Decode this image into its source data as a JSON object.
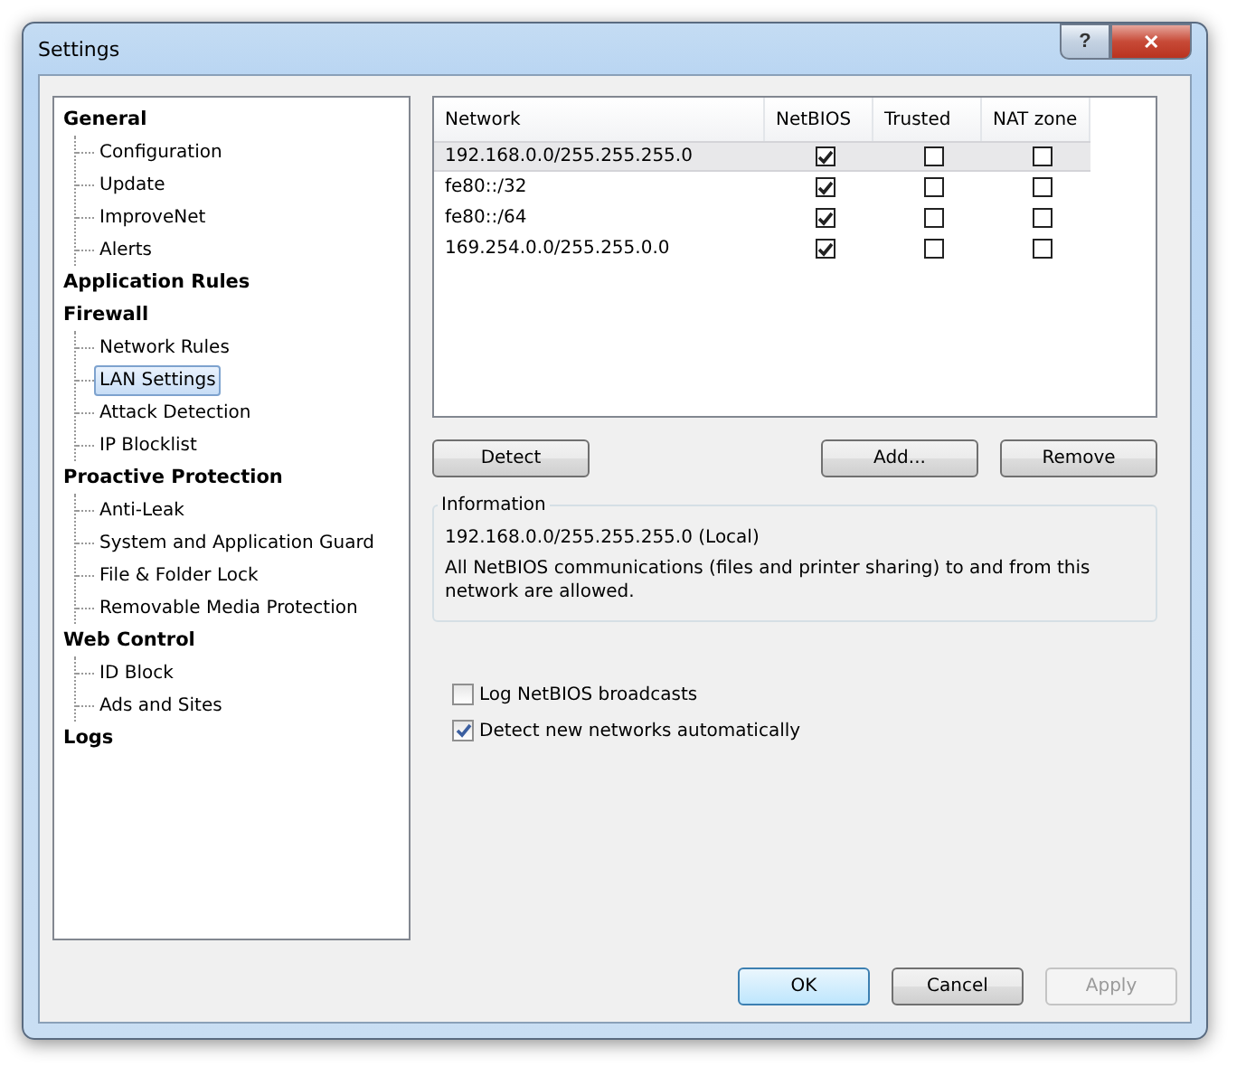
{
  "window": {
    "title": "Settings"
  },
  "title_buttons": [
    {
      "kind": "help",
      "label": "?"
    },
    {
      "kind": "close",
      "label": "✕"
    }
  ],
  "sidebar": {
    "items": [
      {
        "label": "General",
        "selected": false,
        "children": [
          {
            "label": "Configuration",
            "selected": false
          },
          {
            "label": "Update",
            "selected": false
          },
          {
            "label": "ImproveNet",
            "selected": false
          },
          {
            "label": "Alerts",
            "selected": false
          }
        ]
      },
      {
        "label": "Application Rules",
        "selected": false
      },
      {
        "label": "Firewall",
        "selected": false,
        "children": [
          {
            "label": "Network Rules",
            "selected": false
          },
          {
            "label": "LAN Settings",
            "selected": true
          },
          {
            "label": "Attack Detection",
            "selected": false
          },
          {
            "label": "IP Blocklist",
            "selected": false
          }
        ]
      },
      {
        "label": "Proactive Protection",
        "selected": false,
        "children": [
          {
            "label": "Anti-Leak",
            "selected": false
          },
          {
            "label": "System and Application Guard",
            "selected": false
          },
          {
            "label": "File & Folder Lock",
            "selected": false
          },
          {
            "label": "Removable Media Protection",
            "selected": false
          }
        ]
      },
      {
        "label": "Web Control",
        "selected": false,
        "children": [
          {
            "label": "ID Block",
            "selected": false
          },
          {
            "label": "Ads and Sites",
            "selected": false
          }
        ]
      },
      {
        "label": "Logs",
        "selected": false
      }
    ]
  },
  "table": {
    "columns": [
      "Network",
      "NetBIOS",
      "Trusted",
      "NAT zone"
    ],
    "rows": [
      {
        "network": "192.168.0.0/255.255.255.0",
        "netbios": true,
        "trusted": false,
        "nat_zone": false,
        "selected": true
      },
      {
        "network": "fe80::/32",
        "netbios": true,
        "trusted": false,
        "nat_zone": false,
        "selected": false
      },
      {
        "network": "fe80::/64",
        "netbios": true,
        "trusted": false,
        "nat_zone": false,
        "selected": false
      },
      {
        "network": "169.254.0.0/255.255.0.0",
        "netbios": true,
        "trusted": false,
        "nat_zone": false,
        "selected": false
      }
    ]
  },
  "table_buttons": [
    {
      "label": "Detect"
    },
    {
      "label": "Add..."
    },
    {
      "label": "Remove"
    }
  ],
  "information": {
    "title": "Information",
    "network": "192.168.0.0/255.255.255.0 (Local)",
    "description": "All NetBIOS communications (files and printer sharing) to and from this network are allowed."
  },
  "options": [
    {
      "label": "Log NetBIOS broadcasts",
      "checked": false
    },
    {
      "label": "Detect new networks automatically",
      "checked": true
    }
  ],
  "dialog_buttons": [
    {
      "label": "OK",
      "kind": "default",
      "disabled": false
    },
    {
      "label": "Cancel",
      "kind": "normal",
      "disabled": false
    },
    {
      "label": "Apply",
      "kind": "normal",
      "disabled": true
    }
  ]
}
